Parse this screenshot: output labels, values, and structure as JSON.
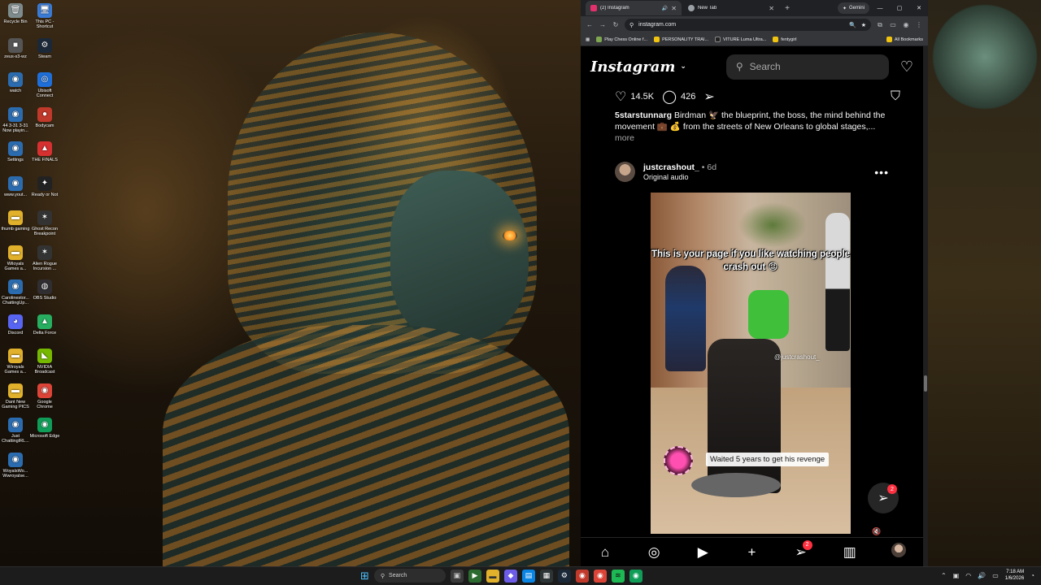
{
  "desktop": {
    "icons": [
      {
        "label": "Recycle Bin",
        "glyph": "🗑",
        "color": "#7f8c8d"
      },
      {
        "label": "This PC - Shortcut",
        "glyph": "🖥",
        "color": "#3a7bd5"
      },
      {
        "label": "zeus-s3-wz",
        "glyph": "■",
        "color": "#555"
      },
      {
        "label": "Steam",
        "glyph": "⚙",
        "color": "#1b2838"
      },
      {
        "label": "watch",
        "glyph": "◉",
        "color": "#2b6cb0"
      },
      {
        "label": "Ubisoft Connect",
        "glyph": "◎",
        "color": "#1e6fd9"
      },
      {
        "label": "44 3-31 3-31 Now playin...",
        "glyph": "◉",
        "color": "#2b6cb0"
      },
      {
        "label": "Bodycam",
        "glyph": "●",
        "color": "#c0392b"
      },
      {
        "label": "Settings",
        "glyph": "◉",
        "color": "#2b6cb0"
      },
      {
        "label": "THE FINALS",
        "glyph": "▲",
        "color": "#d63031"
      },
      {
        "label": "www.yout...",
        "glyph": "◉",
        "color": "#2b6cb0"
      },
      {
        "label": "Ready or Not",
        "glyph": "✦",
        "color": "#222"
      },
      {
        "label": "thumb gaming",
        "glyph": "▬",
        "color": "#e1b12c"
      },
      {
        "label": "Ghost Recon Breakpoint",
        "glyph": "✶",
        "color": "#333"
      },
      {
        "label": "Wiloyals Games a...",
        "glyph": "▬",
        "color": "#e1b12c"
      },
      {
        "label": "Alien Rogue Incursion ...",
        "glyph": "✶",
        "color": "#333"
      },
      {
        "label": "Carolinestor... ChattingUp...",
        "glyph": "◉",
        "color": "#2b6cb0"
      },
      {
        "label": "OBS Studio",
        "glyph": "◍",
        "color": "#302e31"
      },
      {
        "label": "Discord",
        "glyph": "◕",
        "color": "#5865f2"
      },
      {
        "label": "Delta Force",
        "glyph": "▲",
        "color": "#27ae60"
      },
      {
        "label": "Wiroyals Games a...",
        "glyph": "▬",
        "color": "#e1b12c"
      },
      {
        "label": "NVIDIA Broadcast",
        "glyph": "◣",
        "color": "#76b900"
      },
      {
        "label": "Dant New Gaming PICS",
        "glyph": "▬",
        "color": "#e1b12c"
      },
      {
        "label": "Google Chrome",
        "glyph": "◉",
        "color": "#db4437"
      },
      {
        "label": "Just ChattingIRL...",
        "glyph": "◉",
        "color": "#2b6cb0"
      },
      {
        "label": "Microsoft Edge",
        "glyph": "◉",
        "color": "#0f9d58"
      },
      {
        "label": "WoyalsWo... Wwroyalse...",
        "glyph": "◉",
        "color": "#2b6cb0"
      }
    ]
  },
  "browser": {
    "tabs": [
      {
        "title": "(2) Instagram",
        "active": true,
        "favicon_color": "#e1306c"
      },
      {
        "title": "New Tab",
        "active": false,
        "favicon_color": "#9aa0a6"
      }
    ],
    "gemini_label": "Gemini",
    "url": "instagram.com",
    "bookmarks": [
      {
        "label": "Play Chess Online f...",
        "color": "#7fa650"
      },
      {
        "label": "PERSONALITY TRAI...",
        "color": "#f1c40f"
      },
      {
        "label": "VITURE Luma Ultra...",
        "color": "#222"
      },
      {
        "label": "fentygirl",
        "color": "#f1c40f"
      }
    ],
    "all_bookmarks_label": "All Bookmarks"
  },
  "instagram": {
    "logo": "Instagram",
    "search_placeholder": "Search",
    "post": {
      "likes": "14.5K",
      "comments": "426",
      "caption_user": "5starstunnarg",
      "caption_text": "Birdman 🦅 the blueprint, the boss, the mind behind the movement 💼 💰 from the streets of New Orleans to global stages,...",
      "more_label": "more"
    },
    "next_post": {
      "username": "justcrashout_",
      "age": "• 6d",
      "audio": "Original audio",
      "overlay_top": "This is your page if you like watching people crash out 😡",
      "watermark": "@justcrashout_",
      "overlay_bottom": "Waited 5 years to get his revenge"
    },
    "share_badge": "2",
    "nav_badge": "2"
  },
  "taskbar": {
    "search_label": "Search",
    "time": "7:18 AM",
    "date": "1/6/2026"
  }
}
